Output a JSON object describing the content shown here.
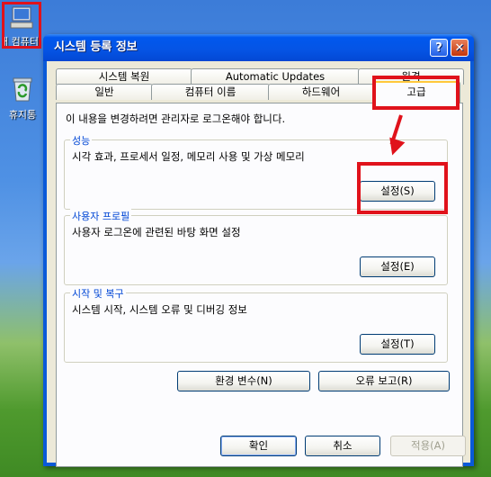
{
  "desktop": {
    "computer_icon_label": "내 컴퓨터",
    "recycle_icon_label": "휴지통"
  },
  "window": {
    "title": "시스템 등록 정보",
    "help_glyph": "?",
    "close_glyph": "✕"
  },
  "tabs": {
    "row1": [
      "시스템 복원",
      "Automatic Updates",
      "원격"
    ],
    "row2": [
      "일반",
      "컴퓨터 이름",
      "하드웨어",
      "고급"
    ],
    "active": "고급"
  },
  "advanced": {
    "admin_note": "이 내용을 변경하려면 관리자로 로그온해야 합니다.",
    "performance": {
      "title": "성능",
      "desc": "시각 효과, 프로세서 일정, 메모리 사용 및 가상 메모리",
      "button": "설정(S)"
    },
    "profiles": {
      "title": "사용자 프로필",
      "desc": "사용자 로그온에 관련된 바탕 화면 설정",
      "button": "설정(E)"
    },
    "startup": {
      "title": "시작 및 복구",
      "desc": "시스템 시작, 시스템 오류 및 디버깅 정보",
      "button": "설정(T)"
    },
    "env_button": "환경 변수(N)",
    "error_button": "오류 보고(R)"
  },
  "footer": {
    "ok": "확인",
    "cancel": "취소",
    "apply": "적용(A)"
  },
  "annotation_color": "#e0121b"
}
